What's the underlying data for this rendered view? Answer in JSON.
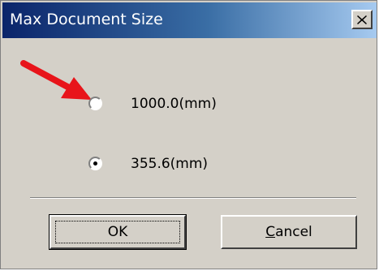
{
  "dialog": {
    "title": "Max Document Size",
    "close_icon": "close-icon"
  },
  "options": [
    {
      "label": "1000.0(mm)",
      "selected": false
    },
    {
      "label": "355.6(mm)",
      "selected": true
    }
  ],
  "annotation": {
    "arrow_icon": "red-arrow-icon",
    "arrow_color": "#e8141a"
  },
  "buttons": {
    "ok_label": "OK",
    "cancel_label": "Cancel"
  }
}
